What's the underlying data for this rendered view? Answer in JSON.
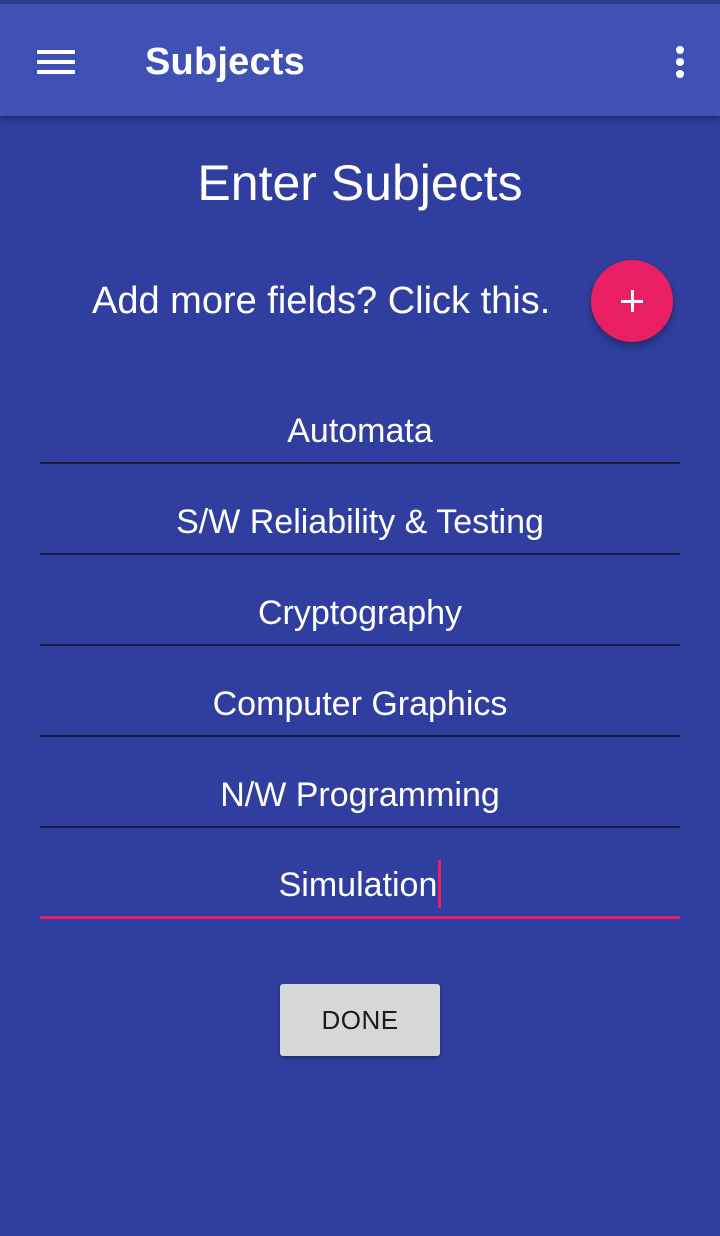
{
  "appbar": {
    "title": "Subjects",
    "menu_icon": "hamburger-menu-icon",
    "overflow_icon": "more-vert-icon",
    "color": "#3f51b5"
  },
  "main": {
    "heading": "Enter Subjects",
    "add_prompt": "Add more fields? Click this.",
    "fab_icon": "plus-icon",
    "fab_color": "#e91e63",
    "background": "#303f9f"
  },
  "fields": [
    {
      "value": "Automata"
    },
    {
      "value": "S/W Reliability & Testing"
    },
    {
      "value": "Cryptography"
    },
    {
      "value": "Computer Graphics"
    },
    {
      "value": "N/W Programming"
    },
    {
      "value": "Simulation"
    }
  ],
  "done_label": "DONE"
}
